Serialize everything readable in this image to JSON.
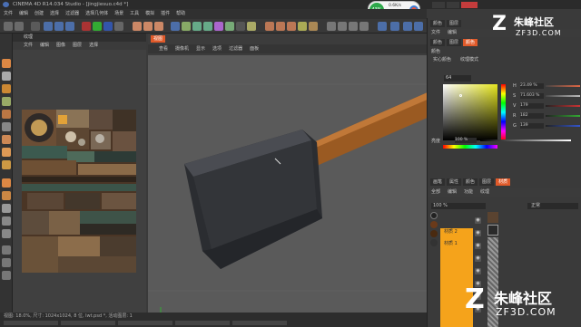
{
  "window": {
    "title": "CINEMA 4D R14.034 Studio - [jingjiesuo.c4d *]"
  },
  "menu": [
    "文件",
    "编辑",
    "创建",
    "选择",
    "工具",
    "网格",
    "捕捉",
    "动画",
    "模拟",
    "渲染",
    "雕刻",
    "运动跟踪",
    "角色",
    "流水线",
    "插件",
    "脚本",
    "窗口",
    "帮助"
  ],
  "menu_visible": [
    "文件",
    "编辑",
    "创建",
    "选择",
    "过滤器",
    "选择几何体",
    "场景",
    "工具",
    "模拟",
    "插件",
    "帮助"
  ],
  "badge": {
    "percent": "43%",
    "line1": "0.6K/s",
    "line2": "0.2K/s"
  },
  "watermark": {
    "top_cn": "朱峰社区",
    "top_en": "ZF3D.COM",
    "bottom_cn": "朱峰社区",
    "bottom_en": "ZF3D.COM"
  },
  "texture_panel": {
    "title": "纹理",
    "menu": [
      "文件",
      "编辑",
      "图像",
      "图层",
      "选择"
    ]
  },
  "viewport": {
    "tab": "视图",
    "menu": [
      "查看",
      "摄像机",
      "显示",
      "选项",
      "过滤器",
      "面板"
    ]
  },
  "color_panel": {
    "tabs": [
      "颜色",
      "图层"
    ],
    "sub_tabs": [
      "文件",
      "编辑"
    ],
    "mode_tabs": [
      "颜色",
      "图层",
      "颜色"
    ],
    "section": "颜色",
    "options": [
      "实心颜色",
      "纹理模式"
    ],
    "hex_label": "64",
    "rows": [
      {
        "label": "H",
        "value": "23.49 %",
        "color": "#d64"
      },
      {
        "label": "S",
        "value": "71.603 %",
        "color": "#999"
      },
      {
        "label": "V",
        "value": "179",
        "color": "#c33"
      },
      {
        "label": "R",
        "value": "182",
        "color": "#3a3"
      },
      {
        "label": "G",
        "value": "139",
        "color": "#35c"
      }
    ],
    "brightness_label": "亮度",
    "brightness_value": "100 %"
  },
  "layers_panel": {
    "tabs": [
      "画笔",
      "属性",
      "颜色",
      "图层",
      "材质"
    ],
    "menu": [
      "全部",
      "编辑",
      "功能",
      "纹理"
    ],
    "opacity": "100 %",
    "mode": "正常",
    "materials": [
      {
        "name": "材质 2"
      },
      {
        "name": "材质 1"
      }
    ]
  },
  "status": {
    "line1": "视图: 18.0%, 尺寸: 1024x1024, 8 位, lwt.psd *, 活动图层: 1"
  }
}
